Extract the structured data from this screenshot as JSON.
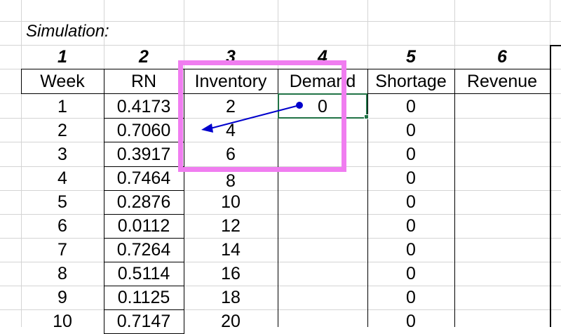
{
  "title": "Simulation:",
  "column_numbers": [
    "1",
    "2",
    "3",
    "4",
    "5",
    "6"
  ],
  "headers": [
    "Week",
    "RN",
    "Inventory",
    "Demand",
    "Shortage",
    "Revenue"
  ],
  "rows": [
    {
      "week": "1",
      "rn": "0.4173",
      "inventory": "2",
      "demand": "0",
      "shortage": "0"
    },
    {
      "week": "2",
      "rn": "0.7060",
      "inventory": "4",
      "demand": "",
      "shortage": "0"
    },
    {
      "week": "3",
      "rn": "0.3917",
      "inventory": "6",
      "demand": "",
      "shortage": "0"
    },
    {
      "week": "4",
      "rn": "0.7464",
      "inventory": "8",
      "demand": "",
      "shortage": "0"
    },
    {
      "week": "5",
      "rn": "0.2876",
      "inventory": "10",
      "demand": "",
      "shortage": "0"
    },
    {
      "week": "6",
      "rn": "0.0112",
      "inventory": "12",
      "demand": "",
      "shortage": "0"
    },
    {
      "week": "7",
      "rn": "0.7264",
      "inventory": "14",
      "demand": "",
      "shortage": "0"
    },
    {
      "week": "8",
      "rn": "0.5114",
      "inventory": "16",
      "demand": "",
      "shortage": "0"
    },
    {
      "week": "9",
      "rn": "0.1125",
      "inventory": "18",
      "demand": "",
      "shortage": "0"
    },
    {
      "week": "10",
      "rn": "0.7147",
      "inventory": "20",
      "demand": "",
      "shortage": "0"
    }
  ],
  "colors": {
    "highlight": "#f07df0",
    "selection": "#217346",
    "trace_arrow": "#0000cc",
    "gridline": "#d4d4d4"
  }
}
